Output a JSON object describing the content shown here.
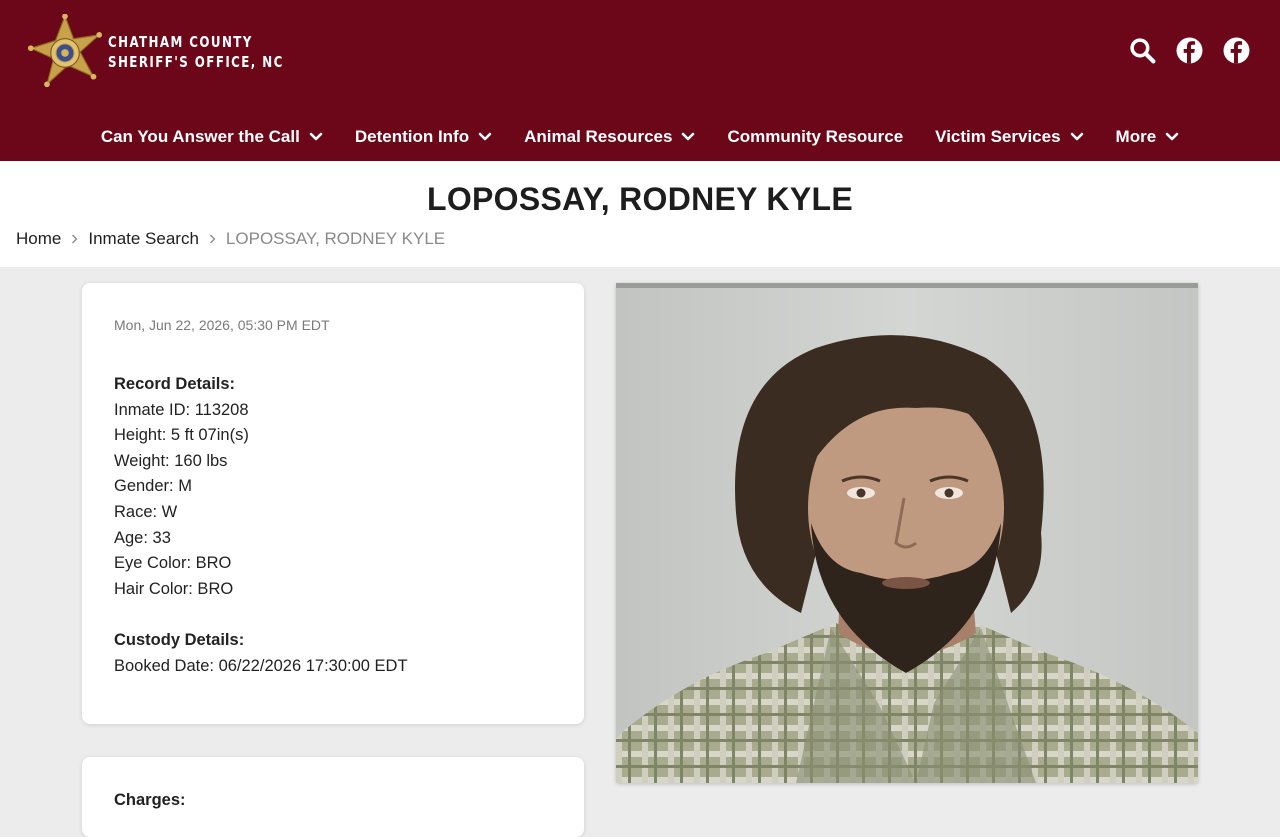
{
  "header": {
    "org_line1": "CHATHAM COUNTY",
    "org_line2": "SHERIFF'S OFFICE, NC",
    "badge_icon": "sheriff-star-badge-icon",
    "icons": [
      "search-icon",
      "facebook-icon",
      "facebook-icon"
    ],
    "brand_color": "#6b0719"
  },
  "nav": {
    "items": [
      {
        "label": "Can You Answer the Call",
        "has_dropdown": true
      },
      {
        "label": "Detention Info",
        "has_dropdown": true
      },
      {
        "label": "Animal Resources",
        "has_dropdown": true
      },
      {
        "label": "Community Resource",
        "has_dropdown": false
      },
      {
        "label": "Victim Services",
        "has_dropdown": true
      },
      {
        "label": "More",
        "has_dropdown": true
      }
    ]
  },
  "page": {
    "title": "LOPOSSAY, RODNEY KYLE"
  },
  "breadcrumb": {
    "home": "Home",
    "section": "Inmate Search",
    "current": "LOPOSSAY, RODNEY KYLE"
  },
  "record": {
    "timestamp": "Mon, Jun 22, 2026, 05:30 PM EDT",
    "record_heading": "Record Details:",
    "inmate_id": "Inmate ID: 113208",
    "height": "Height: 5 ft 07in(s)",
    "weight": "Weight: 160 lbs",
    "gender": "Gender: M",
    "race": "Race: W",
    "age": "Age: 33",
    "eye_color": "Eye Color: BRO",
    "hair_color": "Hair Color: BRO",
    "custody_heading": "Custody Details:",
    "booked_date": "Booked Date: 06/22/2026 17:30:00 EDT"
  },
  "charges": {
    "heading": "Charges:"
  },
  "photo": {
    "alt": "inmate mugshot"
  }
}
